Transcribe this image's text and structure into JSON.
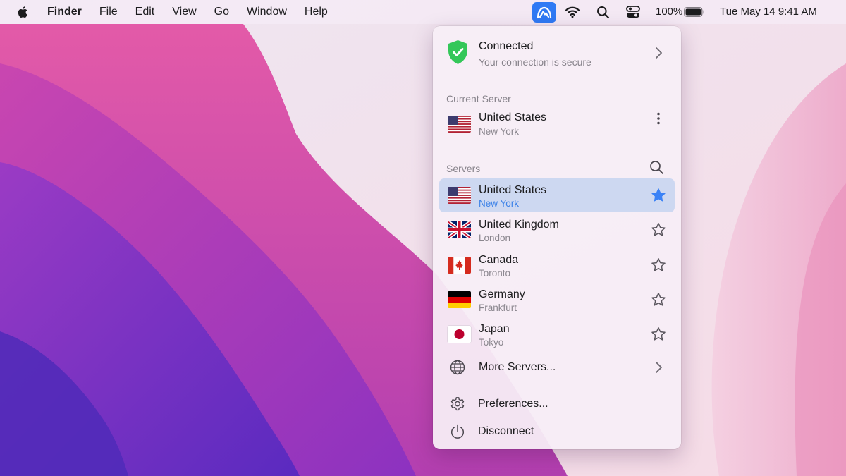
{
  "menubar": {
    "app_name": "Finder",
    "menus": [
      "File",
      "Edit",
      "View",
      "Go",
      "Window",
      "Help"
    ],
    "battery": "100%",
    "datetime": "Tue May 14  9:41 AM"
  },
  "status": {
    "title": "Connected",
    "subtitle": "Your connection is secure",
    "color": "#34c759"
  },
  "current_server": {
    "label": "Current Server",
    "country": "United States",
    "city": "New York"
  },
  "servers": {
    "label": "Servers",
    "items": [
      {
        "country": "United States",
        "city": "New York",
        "flag": "us",
        "favorite": true,
        "selected": true
      },
      {
        "country": "United Kingdom",
        "city": "London",
        "flag": "gb",
        "favorite": false,
        "selected": false
      },
      {
        "country": "Canada",
        "city": "Toronto",
        "flag": "ca",
        "favorite": false,
        "selected": false
      },
      {
        "country": "Germany",
        "city": "Frankfurt",
        "flag": "de",
        "favorite": false,
        "selected": false
      },
      {
        "country": "Japan",
        "city": "Tokyo",
        "flag": "jp",
        "favorite": false,
        "selected": false
      }
    ],
    "more_label": "More Servers..."
  },
  "actions": {
    "preferences": "Preferences...",
    "disconnect": "Disconnect"
  },
  "colors": {
    "accent": "#2f7af4",
    "selection": "#c5d4f0",
    "favorite_star": "#3b82f6"
  },
  "icons": {
    "apple": "apple-logo-icon",
    "vpn": "vpn-mountain-icon",
    "wifi": "wifi-icon",
    "search": "search-icon",
    "control_center": "control-center-icon",
    "battery": "battery-icon",
    "shield": "shield-check-icon",
    "chevron": "chevron-right-icon",
    "more": "more-vertical-icon",
    "globe": "globe-icon",
    "gear": "gear-icon",
    "power": "power-icon",
    "star": "star-icon"
  }
}
